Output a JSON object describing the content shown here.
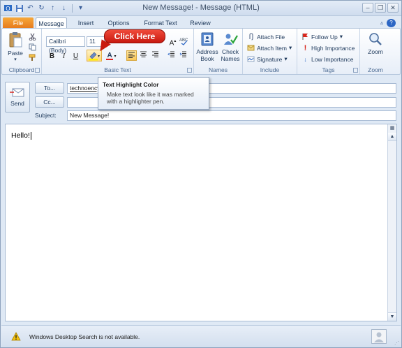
{
  "window": {
    "title": "New Message!  -  Message (HTML)"
  },
  "tabs": {
    "file": "File",
    "message": "Message",
    "insert": "Insert",
    "options": "Options",
    "format_text": "Format Text",
    "review": "Review"
  },
  "ribbon": {
    "clipboard": {
      "paste_label": "Paste",
      "group_label": "Clipboard"
    },
    "basic_text": {
      "font_name": "Calibri (Body)",
      "font_size": "11",
      "bold": "B",
      "italic": "I",
      "underline": "U",
      "font_color_glyph": "A",
      "group_label": "Basic Text"
    },
    "names": {
      "address_book_label": "Address Book",
      "check_names_label": "Check Names",
      "group_label": "Names"
    },
    "include": {
      "attach_file": "Attach File",
      "attach_item": "Attach Item",
      "signature": "Signature",
      "group_label": "Include"
    },
    "tags": {
      "follow_up": "Follow Up",
      "high_importance": "High Importance",
      "low_importance": "Low Importance",
      "group_label": "Tags"
    },
    "zoom": {
      "zoom_label": "Zoom",
      "group_label": "Zoom"
    }
  },
  "callout": {
    "text": "Click Here"
  },
  "tooltip": {
    "title": "Text Highlight Color",
    "body": "Make text look like it was marked with a highlighter pen."
  },
  "compose": {
    "send_label": "Send",
    "to_label": "To...",
    "to_value": "technoency",
    "cc_label": "Cc...",
    "cc_value": "",
    "subject_label": "Subject:",
    "subject_value": "New Message!",
    "body_text": "Hello!"
  },
  "status": {
    "message": "Windows Desktop Search is not available."
  },
  "colors": {
    "accent_blue": "#2c66c4",
    "file_tab_orange": "#e5781b",
    "callout_red": "#c91a10",
    "highlight_yellow": "#fbd77b"
  }
}
